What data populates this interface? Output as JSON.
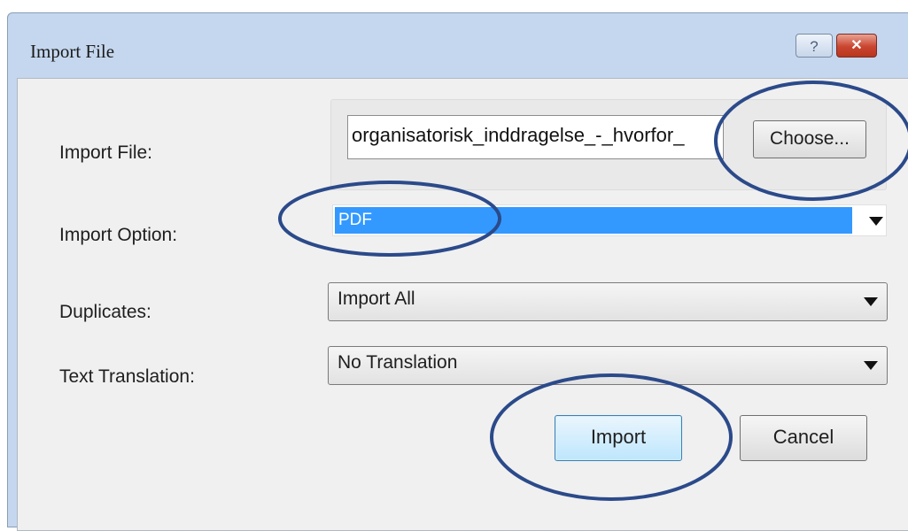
{
  "dialog": {
    "title": "Import File",
    "help_glyph": "?",
    "close_glyph": "✕"
  },
  "form": {
    "import_file_label": "Import File:",
    "import_file_value": "organisatorisk_inddragelse_-_hvorfor_",
    "choose_label": "Choose...",
    "import_option_label": "Import Option:",
    "import_option_value": "PDF",
    "duplicates_label": "Duplicates:",
    "duplicates_value": "Import All",
    "text_translation_label": "Text Translation:",
    "text_translation_value": "No Translation"
  },
  "buttons": {
    "import_label": "Import",
    "cancel_label": "Cancel"
  },
  "colors": {
    "annotation_ring": "#2b4a8a",
    "selection_highlight": "#3399ff",
    "titlebar": "#c5d7ee"
  },
  "icons": [
    "help-icon",
    "close-icon",
    "chevron-down-icon"
  ]
}
